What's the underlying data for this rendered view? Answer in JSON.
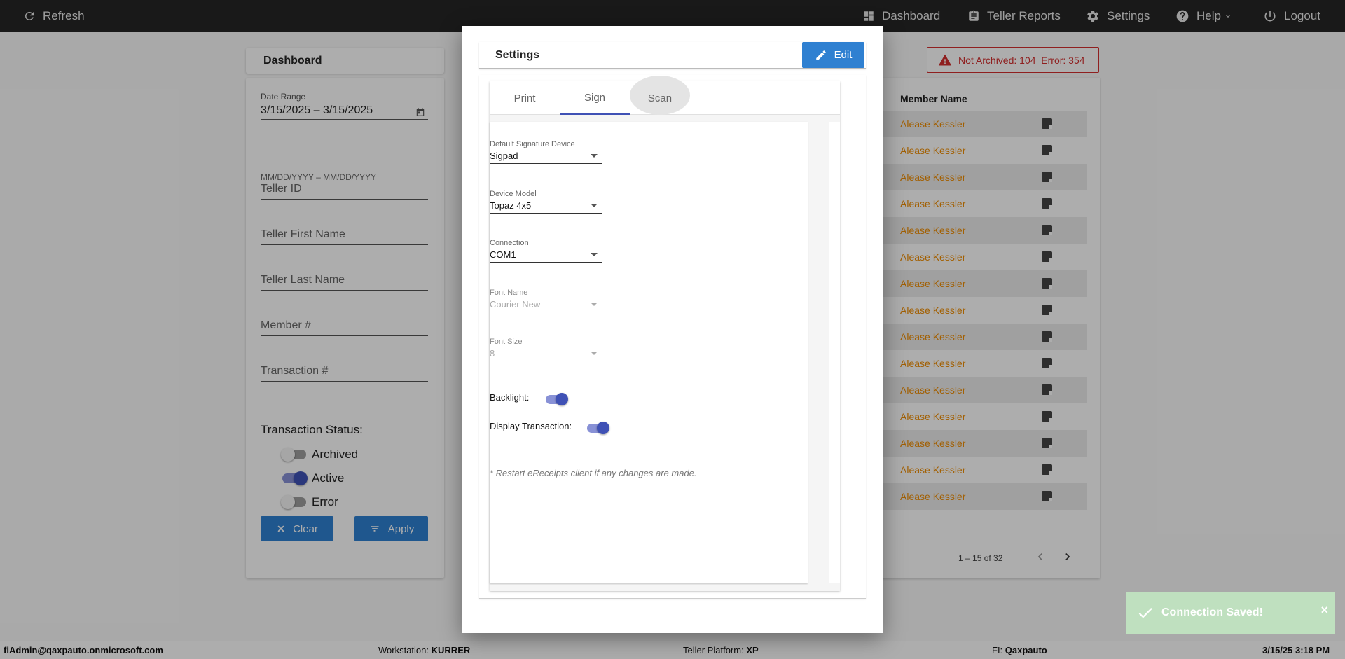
{
  "topbar": {
    "refresh": "Refresh",
    "dashboard": "Dashboard",
    "teller_reports": "Teller Reports",
    "settings": "Settings",
    "help": "Help",
    "logout": "Logout"
  },
  "dashboard": {
    "title": "Dashboard",
    "date_range_label": "Date Range",
    "date_range_value": "3/15/2025 – 3/15/2025",
    "date_format_hint": "MM/DD/YYYY – MM/DD/YYYY",
    "teller_id": "Teller ID",
    "teller_first_name": "Teller First Name",
    "teller_last_name": "Teller Last Name",
    "member_number": "Member #",
    "transaction_number": "Transaction #",
    "transaction_status_label": "Transaction Status:",
    "status_archived": "Archived",
    "status_active": "Active",
    "status_error": "Error",
    "clear_button": "Clear",
    "apply_button": "Apply"
  },
  "alert": {
    "text": "Not Archived: 104  Error: 354"
  },
  "table": {
    "member_name_header": "Member Name",
    "rows": [
      "Alease Kessler",
      "Alease Kessler",
      "Alease Kessler",
      "Alease Kessler",
      "Alease Kessler",
      "Alease Kessler",
      "Alease Kessler",
      "Alease Kessler",
      "Alease Kessler",
      "Alease Kessler",
      "Alease Kessler",
      "Alease Kessler",
      "Alease Kessler",
      "Alease Kessler",
      "Alease Kessler"
    ],
    "pagination": "1 – 15 of 32"
  },
  "modal": {
    "title": "Settings",
    "edit_button": "Edit",
    "tabs": [
      "Print",
      "Sign",
      "Scan"
    ],
    "fields": {
      "default_signature_device": {
        "label": "Default Signature Device",
        "value": "Sigpad"
      },
      "device_model": {
        "label": "Device Model",
        "value": "Topaz 4x5"
      },
      "connection": {
        "label": "Connection",
        "value": "COM1"
      },
      "font_name": {
        "label": "Font Name",
        "value": "Courier New"
      },
      "font_size": {
        "label": "Font Size",
        "value": "8"
      }
    },
    "backlight_label": "Backlight:",
    "display_transaction_label": "Display Transaction:",
    "restart_note": "* Restart eReceipts client if any changes are made."
  },
  "toast": {
    "message": "Connection Saved!",
    "close": "×"
  },
  "footer": {
    "user": "fiAdmin@qaxpauto.onmicrosoft.com",
    "workstation_label": "Workstation:",
    "workstation_value": "KURRER",
    "platform_label": "Teller Platform:",
    "platform_value": "XP",
    "fi_label": "FI:",
    "fi_value": "Qaxpauto",
    "datetime": "3/15/25 3:18 PM"
  },
  "colors": {
    "accent_blue": "#2f80d1",
    "tab_indicator": "#3f51b5",
    "alert_red": "#d32f2f",
    "member_link": "#ef8c00",
    "toast_green": "#bfe0bf"
  }
}
